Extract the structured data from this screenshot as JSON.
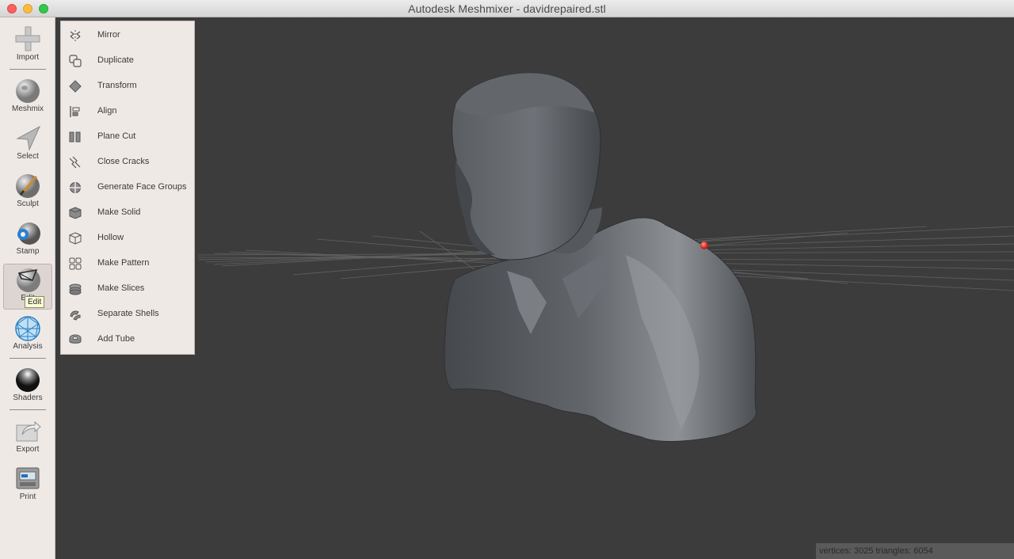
{
  "window": {
    "title": "Autodesk Meshmixer - davidrepaired.stl"
  },
  "toolbar": {
    "items": [
      {
        "label": "Import",
        "icon": "plus-icon"
      },
      {
        "label": "Meshmix",
        "icon": "bunny-ball-icon"
      },
      {
        "label": "Select",
        "icon": "cursor-arrow-icon"
      },
      {
        "label": "Sculpt",
        "icon": "brush-sphere-icon"
      },
      {
        "label": "Stamp",
        "icon": "stamp-sphere-icon"
      },
      {
        "label": "Edit",
        "icon": "edit-mesh-icon"
      },
      {
        "label": "Analysis",
        "icon": "wireframe-sphere-icon"
      },
      {
        "label": "Shaders",
        "icon": "chrome-sphere-icon"
      },
      {
        "label": "Export",
        "icon": "export-arrow-icon"
      },
      {
        "label": "Print",
        "icon": "printer-icon"
      }
    ],
    "active": "Edit",
    "tooltip": "Edit"
  },
  "edit_menu": {
    "items": [
      {
        "label": "Mirror",
        "icon": "mirror-icon"
      },
      {
        "label": "Duplicate",
        "icon": "duplicate-icon"
      },
      {
        "label": "Transform",
        "icon": "transform-icon"
      },
      {
        "label": "Align",
        "icon": "align-icon"
      },
      {
        "label": "Plane Cut",
        "icon": "plane-cut-icon"
      },
      {
        "label": "Close Cracks",
        "icon": "close-cracks-icon"
      },
      {
        "label": "Generate Face Groups",
        "icon": "face-groups-icon"
      },
      {
        "label": "Make Solid",
        "icon": "make-solid-icon"
      },
      {
        "label": "Hollow",
        "icon": "hollow-icon"
      },
      {
        "label": "Make Pattern",
        "icon": "make-pattern-icon"
      },
      {
        "label": "Make Slices",
        "icon": "make-slices-icon"
      },
      {
        "label": "Separate Shells",
        "icon": "separate-shells-icon"
      },
      {
        "label": "Add Tube",
        "icon": "add-tube-icon"
      }
    ]
  },
  "viewport": {
    "model": "bust-mesh",
    "status_text": "vertices: 3025 triangles: 6054"
  },
  "colors": {
    "toolbar_bg": "#efe9e6",
    "viewport_bg": "#3c3c3c",
    "mesh": "#5d6064",
    "pivot_dot": "#e8403a"
  }
}
